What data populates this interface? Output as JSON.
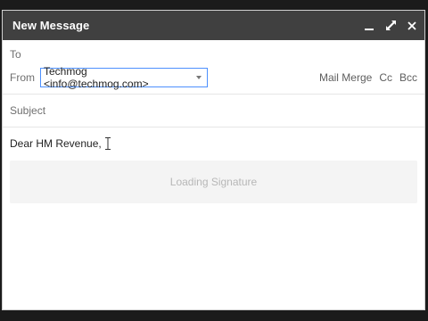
{
  "window": {
    "title": "New Message"
  },
  "header": {
    "to_label": "To",
    "from_label": "From",
    "from_value": "Techmog <info@techmog.com>",
    "actions": [
      "Mail Merge",
      "Cc",
      "Bcc"
    ],
    "subject_placeholder": "Subject"
  },
  "body": {
    "text": "Dear HM Revenue,",
    "signature_status": "Loading Signature"
  },
  "colors": {
    "titlebar": "#404040",
    "select_border": "#4d90fe",
    "signature_bg": "#f4f4f4"
  }
}
